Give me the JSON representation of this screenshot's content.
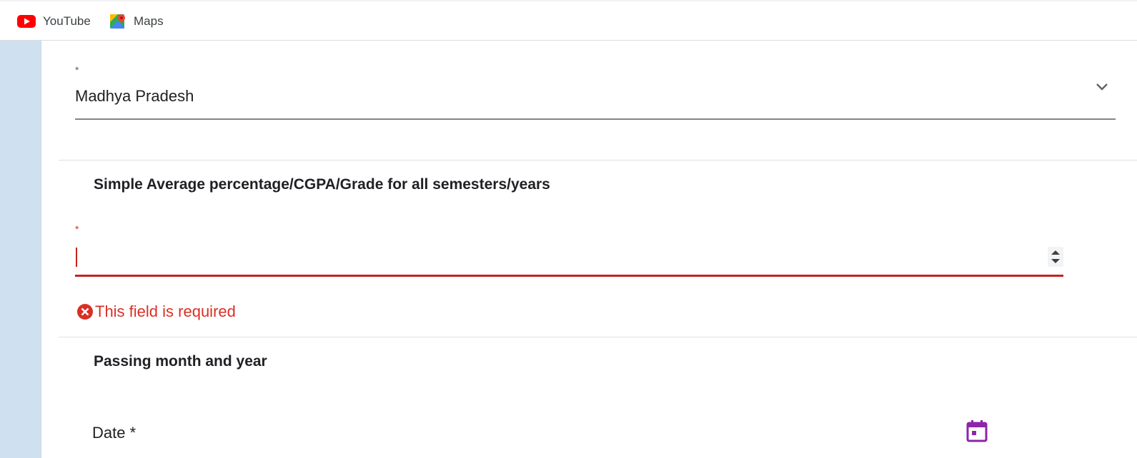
{
  "bookmarks": [
    {
      "label": "YouTube",
      "icon": "youtube-icon"
    },
    {
      "label": "Maps",
      "icon": "maps-icon"
    }
  ],
  "state_select": {
    "required_marker": "*",
    "value": "Madhya Pradesh"
  },
  "percentage_section": {
    "title": "Simple Average percentage/CGPA/Grade for all semesters/years",
    "required_marker": "*",
    "value": "",
    "error": "This field is required"
  },
  "passing_section": {
    "title": "Passing month and year",
    "date_label": "Date *"
  },
  "colors": {
    "error": "#d93025",
    "calendar_icon": "#8e24aa",
    "left_strip": "#cfe0f1"
  }
}
